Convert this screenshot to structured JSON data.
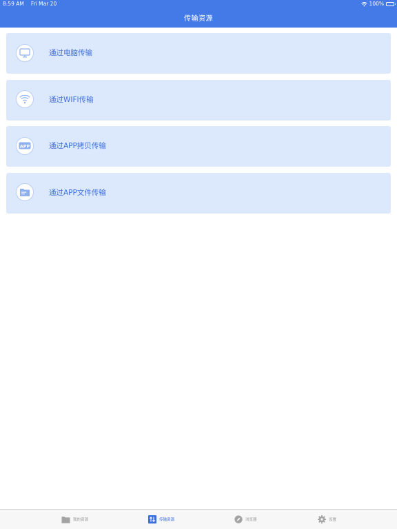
{
  "status_bar": {
    "time": "8:59 AM",
    "date": "Fri Mar 20",
    "battery": "100%",
    "wifi_icon": "wifi-icon",
    "battery_icon": "battery-icon"
  },
  "header": {
    "title": "传输资源"
  },
  "transfer_options": [
    {
      "label": "通过电脑传输",
      "icon": "computer-icon"
    },
    {
      "label": "通过WIFI传输",
      "icon": "wifi-icon"
    },
    {
      "label": "通过APP拷贝传输",
      "icon": "app-icon"
    },
    {
      "label": "通过APP文件传输",
      "icon": "folder-icon"
    }
  ],
  "tabbar": {
    "tabs": [
      {
        "label": "我的资源",
        "icon": "folder-icon",
        "active": false
      },
      {
        "label": "传输资源",
        "icon": "transfer-icon",
        "active": true
      },
      {
        "label": "浏览器",
        "icon": "compass-icon",
        "active": false
      },
      {
        "label": "设置",
        "icon": "gear-icon",
        "active": false
      }
    ]
  },
  "colors": {
    "header_bg": "#4479e8",
    "card_bg": "#dce8fb",
    "accent": "#3d6fdc",
    "inactive": "#9a9a9a"
  }
}
